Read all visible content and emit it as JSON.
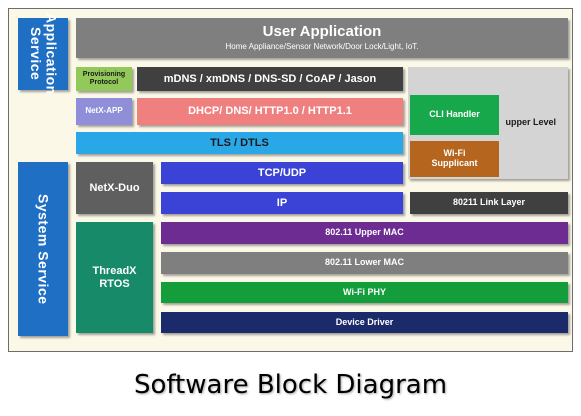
{
  "diagram": {
    "application_service_label": "Application Service",
    "system_service_label": "System Service",
    "user_application": {
      "title": "User Application",
      "subtitle": "Home Appliance/Sensor Network/Door Lock/Light, IoT."
    },
    "provisioning_protocol": "Provisioning Protocol",
    "mdns_stack": "mDNS / xmDNS / DNS-SD / CoAP / Jason",
    "netx_app": "NetX-APP",
    "dhcp_stack": "DHCP/ DNS/ HTTP1.0 / HTTP1.1",
    "upper_level": "upper Level",
    "cli_handler": "CLI Handler",
    "wifi_supplicant": "Wi-Fi Supplicant",
    "tls_dtls": "TLS / DTLS",
    "netx_duo": "NetX-Duo",
    "tcp_udp": "TCP/UDP",
    "ip": "IP",
    "link_layer": "80211 Link Layer",
    "threadx_rtos": "ThreadX RTOS",
    "upper_mac": "802.11 Upper MAC",
    "lower_mac": "802.11 Lower MAC",
    "wifi_phy": "Wi-Fi PHY",
    "device_driver": "Device Driver"
  },
  "caption": "Software Block Diagram",
  "colors": {
    "application_service": "#1f6fc4",
    "system_service": "#1f6fc4",
    "user_application": "#7f7f7f",
    "provisioning": "#92c95a",
    "mdns": "#404040",
    "netx_app": "#8e8fd8",
    "dhcp": "#f08080",
    "upper_level": "#d4d4d4",
    "cli_handler": "#17a84b",
    "wifi_supplicant": "#b5651d",
    "tls": "#2aa7e6",
    "netx_duo": "#5f5f5f",
    "tcp_udp": "#3a43d6",
    "ip": "#3a43d6",
    "link_layer": "#404040",
    "threadx": "#178a6a",
    "upper_mac": "#6d2c91",
    "lower_mac": "#7f7f7f",
    "wifi_phy": "#139e3b",
    "device_driver": "#1a2a6b"
  }
}
